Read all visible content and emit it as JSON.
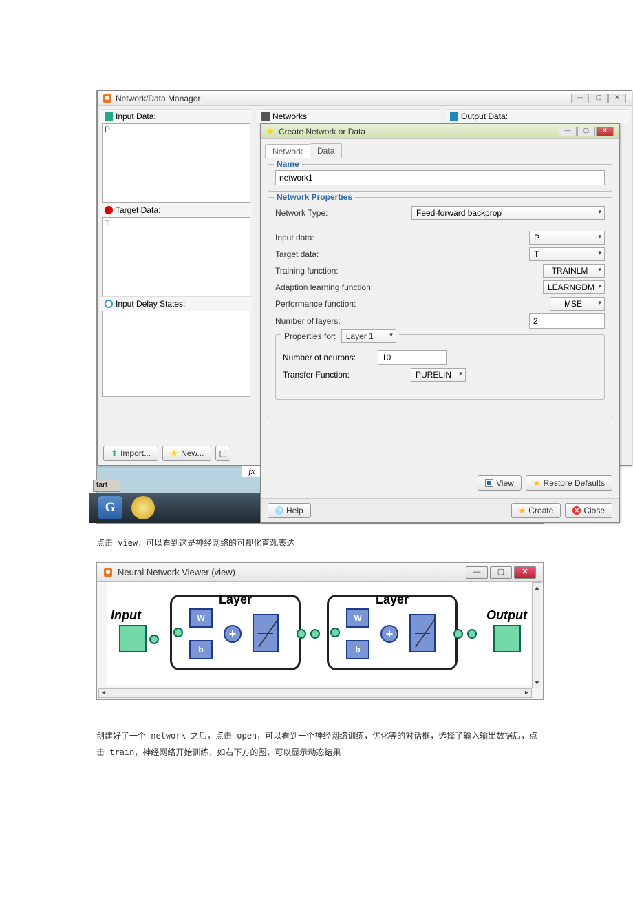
{
  "manager": {
    "title": "Network/Data Manager",
    "inputHeader": "Input Data:",
    "inputItem": "P",
    "targetHeader": "Target Data:",
    "targetItem": "T",
    "delayHeader": "Input Delay States:",
    "networksHeader": "Networks",
    "outputHeader": "Output Data:",
    "importBtn": "Import...",
    "newBtn": "New...",
    "fx": "fx",
    "start": "tart"
  },
  "dialog": {
    "title": "Create Network or Data",
    "tabNetwork": "Network",
    "tabData": "Data",
    "nameLegend": "Name",
    "nameValue": "network1",
    "propsLegend": "Network Properties",
    "typeLabel": "Network Type:",
    "typeValue": "Feed-forward backprop",
    "inputDataLabel": "Input data:",
    "inputDataValue": "P",
    "targetDataLabel": "Target data:",
    "targetDataValue": "T",
    "trainFnLabel": "Training function:",
    "trainFnValue": "TRAINLM",
    "adaptFnLabel": "Adaption learning function:",
    "adaptFnValue": "LEARNGDM",
    "perfFnLabel": "Performance function:",
    "perfFnValue": "MSE",
    "numLayersLabel": "Number of layers:",
    "numLayersValue": "2",
    "propForLabel": "Properties for:",
    "propForValue": "Layer 1",
    "neuronsLabel": "Number of neurons:",
    "neuronsValue": "10",
    "transferLabel": "Transfer Function:",
    "transferValue": "PURELIN",
    "viewBtn": "View",
    "restoreBtn": "Restore Defaults",
    "helpBtn": "Help",
    "createBtn": "Create",
    "closeBtn": "Close"
  },
  "caption1": "点击 view，可以看到这是神经网络的可视化直观表达",
  "viewer": {
    "title": "Neural Network Viewer (view)",
    "input": "Input",
    "layer": "Layer",
    "output": "Output",
    "w": "W",
    "b": "b",
    "plus": "+"
  },
  "caption2": "创建好了一个 network 之后，点击 open，可以看到一个神经网络训练，优化等的对话框，选择了输入输出数据后，点击 train，神经网络开始训练，如右下方的图，可以显示动态结果"
}
